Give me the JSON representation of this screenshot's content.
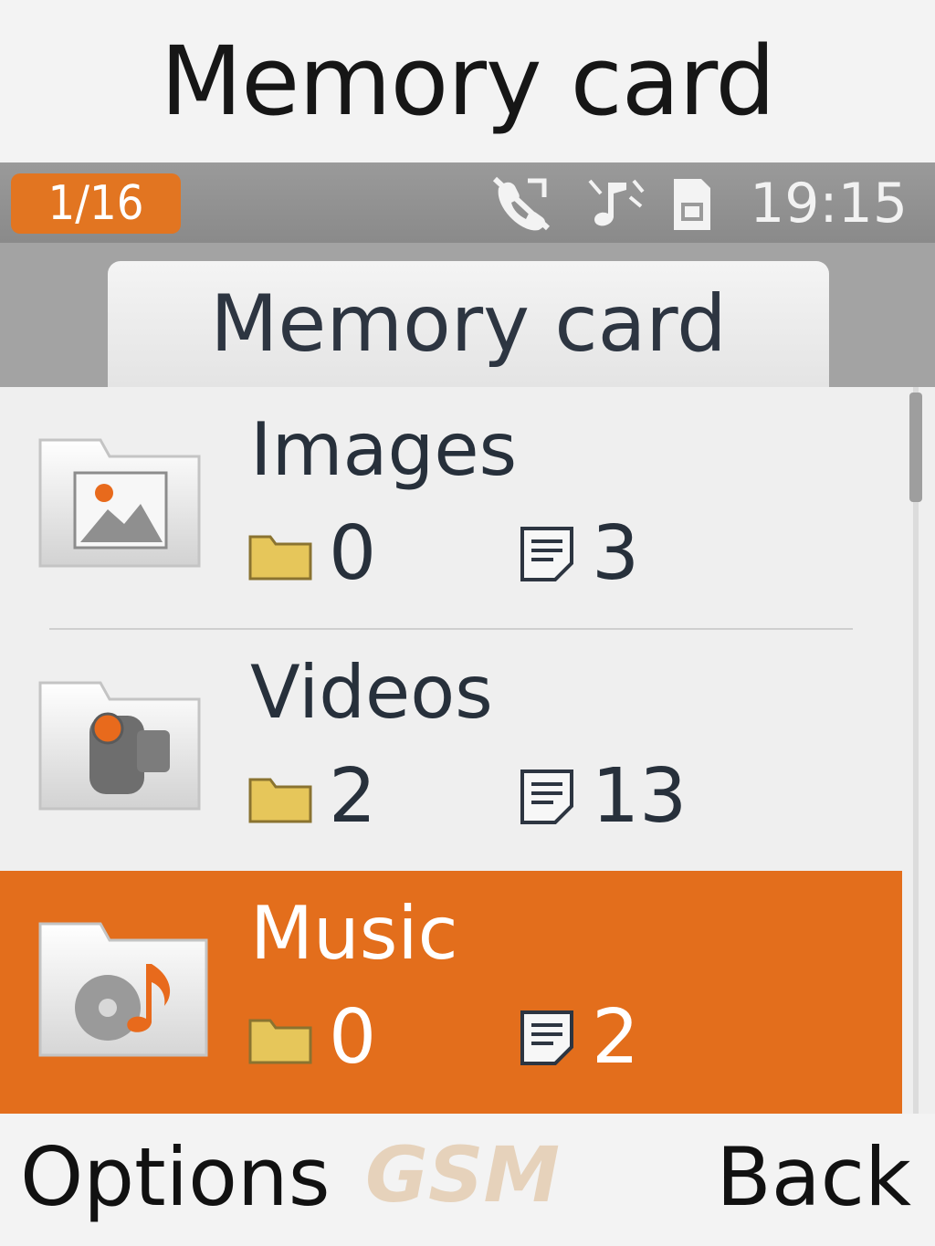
{
  "screen": {
    "title": "Memory card"
  },
  "status": {
    "page_indicator": "1/16",
    "time": "19:15",
    "icons": [
      "missed-call-icon",
      "silent-profile-icon",
      "sim-card-icon"
    ]
  },
  "tab": {
    "label": "Memory card"
  },
  "list": {
    "items": [
      {
        "title": "Images",
        "icon": "images-folder-icon",
        "folder_count": "0",
        "file_count": "3",
        "selected": false
      },
      {
        "title": "Videos",
        "icon": "videos-folder-icon",
        "folder_count": "2",
        "file_count": "13",
        "selected": false
      },
      {
        "title": "Music",
        "icon": "music-folder-icon",
        "folder_count": "0",
        "file_count": "2",
        "selected": true
      }
    ]
  },
  "softkeys": {
    "left": "Options",
    "right": "Back"
  },
  "watermark": "GSM",
  "colors": {
    "accent": "#e36e1c",
    "badge": "#e27521",
    "folder": "#e6c65a"
  }
}
